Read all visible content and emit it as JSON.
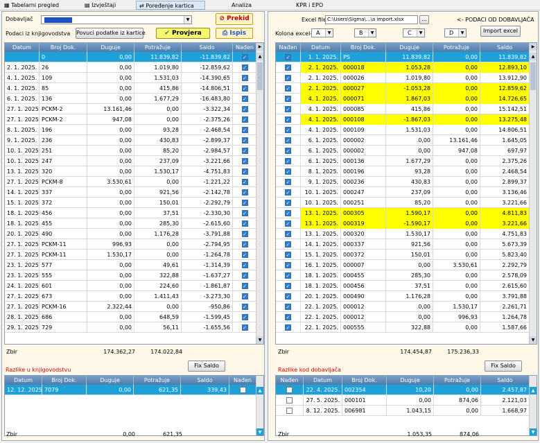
{
  "tabs": [
    {
      "label": "Tabelarni pregled"
    },
    {
      "label": "Izvještaji"
    },
    {
      "label": "Poređenje kartica"
    },
    {
      "label": "Analiza"
    },
    {
      "label": "KPR i EPO"
    }
  ],
  "left": {
    "dobavljac_label": "Dobavljač",
    "prekid": "Prekid",
    "podaci_label": "Podaci iz knjigovodstva",
    "povuci": "Povuci podatke iz kartice",
    "provjera": "Provjera",
    "ispis": "Ispis",
    "headers": [
      "Datum",
      "Broj Dok.",
      "Duguje",
      "Potražuje",
      "Saldo",
      "Nađen"
    ],
    "rows": [
      [
        "",
        "0",
        "0,00",
        "11.839,82",
        "-11.839,82"
      ],
      [
        "2. 1. 2025.",
        "26",
        "0,00",
        "1.019,80",
        "-12.859,62"
      ],
      [
        "4. 1. 2025.",
        "109",
        "0,00",
        "1.531,03",
        "-14.390,65"
      ],
      [
        "4. 1. 2025.",
        "85",
        "0,00",
        "415,86",
        "-14.806,51"
      ],
      [
        "6. 1. 2025.",
        "136",
        "0,00",
        "1.677,29",
        "-16.483,80"
      ],
      [
        "27. 1. 2025.",
        "PCKM-2",
        "13.161,46",
        "0,00",
        "-3.322,34"
      ],
      [
        "27. 1. 2025.",
        "PCKM-2",
        "947,08",
        "0,00",
        "-2.375,26"
      ],
      [
        "8. 1. 2025.",
        "196",
        "0,00",
        "93,28",
        "-2.468,54"
      ],
      [
        "9. 1. 2025.",
        "236",
        "0,00",
        "430,83",
        "-2.899,37"
      ],
      [
        "10. 1. 2025.",
        "251",
        "0,00",
        "85,20",
        "-2.984,57"
      ],
      [
        "10. 1. 2025.",
        "247",
        "0,00",
        "237,09",
        "-3.221,66"
      ],
      [
        "13. 1. 2025.",
        "320",
        "0,00",
        "1.530,17",
        "-4.751,83"
      ],
      [
        "27. 1. 2025.",
        "PCKM-8",
        "3.530,61",
        "0,00",
        "-1.221,22"
      ],
      [
        "14. 1. 2025.",
        "337",
        "0,00",
        "921,56",
        "-2.142,78"
      ],
      [
        "15. 1. 2025.",
        "372",
        "0,00",
        "150,01",
        "-2.292,79"
      ],
      [
        "18. 1. 2025.",
        "456",
        "0,00",
        "37,51",
        "-2.330,30"
      ],
      [
        "18. 1. 2025.",
        "455",
        "0,00",
        "285,30",
        "-2.615,60"
      ],
      [
        "20. 1. 2025.",
        "490",
        "0,00",
        "1.176,28",
        "-3.791,88"
      ],
      [
        "27. 1. 2025.",
        "PCKM-11",
        "996,93",
        "0,00",
        "-2.794,95"
      ],
      [
        "27. 1. 2025.",
        "PCKM-11",
        "1.530,17",
        "0,00",
        "-1.264,78"
      ],
      [
        "23. 1. 2025.",
        "577",
        "0,00",
        "49,61",
        "-1.314,39"
      ],
      [
        "23. 1. 2025.",
        "555",
        "0,00",
        "322,88",
        "-1.637,27"
      ],
      [
        "24. 1. 2025.",
        "601",
        "0,00",
        "224,60",
        "-1.861,87"
      ],
      [
        "27. 1. 2025.",
        "673",
        "0,00",
        "1.411,43",
        "-3.273,30"
      ],
      [
        "27. 1. 2025.",
        "PCKM-16",
        "2.322,44",
        "0,00",
        "-950,86"
      ],
      [
        "28. 1. 2025.",
        "686",
        "0,00",
        "648,59",
        "-1.599,45"
      ],
      [
        "29. 1. 2025.",
        "729",
        "0,00",
        "56,11",
        "-1.655,56"
      ]
    ],
    "zbir": "Zbir",
    "sum_duguje": "174.362,27",
    "sum_potrazuje": "174.022,84",
    "razlike": "Razlike u knjigovodstvu",
    "fix": "Fix Saldo",
    "diff_rows": [
      [
        "12. 12. 2025.",
        "7079",
        "0,00",
        "621,35",
        "339,43"
      ]
    ],
    "diff_zbir_duguje": "0,00",
    "diff_zbir_potrazuje": "621,35"
  },
  "right": {
    "excel_label": "Excel file",
    "excel_path": "C:\\Users\\Sigma\\...\\a import.xlsx",
    "browse": "...",
    "podaci_dob": "<- PODACI OD DOBAVLJAČA",
    "kolona": "Kolona excel-a",
    "cols": [
      "A",
      "B",
      "C",
      "D"
    ],
    "import": "Import excel",
    "headers": [
      "Nađen",
      "Datum",
      "Broj Dok.",
      "Duguje",
      "Potražuje",
      "Saldo"
    ],
    "rows": [
      [
        "1. 1. 2025.",
        "PS",
        "11.839,82",
        "0,00",
        "11.839,82",
        "sel"
      ],
      [
        "2. 1. 2025.",
        "000018",
        "1.053,28",
        "0,00",
        "12.893,10",
        "y"
      ],
      [
        "2. 1. 2025.",
        "000026",
        "1.019,80",
        "0,00",
        "13.912,90",
        ""
      ],
      [
        "2. 1. 2025.",
        "000027",
        "-1.053,28",
        "0,00",
        "12.859,62",
        "y"
      ],
      [
        "4. 1. 2025.",
        "000071",
        "1.867,03",
        "0,00",
        "14.726,65",
        "y"
      ],
      [
        "4. 1. 2025.",
        "000085",
        "415,86",
        "0,00",
        "15.142,51",
        ""
      ],
      [
        "4. 1. 2025.",
        "000108",
        "-1.867,03",
        "0,00",
        "13.275,48",
        "y"
      ],
      [
        "4. 1. 2025.",
        "000109",
        "1.531,03",
        "0,00",
        "14.806,51",
        ""
      ],
      [
        "6. 1. 2025.",
        "000002",
        "0,00",
        "13.161,46",
        "1.645,05",
        ""
      ],
      [
        "6. 1. 2025.",
        "000002",
        "0,00",
        "947,08",
        "697,97",
        ""
      ],
      [
        "6. 1. 2025.",
        "000136",
        "1.677,29",
        "0,00",
        "2.375,26",
        ""
      ],
      [
        "8. 1. 2025.",
        "000196",
        "93,28",
        "0,00",
        "2.468,54",
        ""
      ],
      [
        "9. 1. 2025.",
        "000236",
        "430,83",
        "0,00",
        "2.899,37",
        ""
      ],
      [
        "10. 1. 2025.",
        "000247",
        "237,09",
        "0,00",
        "3.136,46",
        ""
      ],
      [
        "10. 1. 2025.",
        "000251",
        "85,20",
        "0,00",
        "3.221,66",
        ""
      ],
      [
        "13. 1. 2025.",
        "000305",
        "1.590,17",
        "0,00",
        "4.811,83",
        "y"
      ],
      [
        "13. 1. 2025.",
        "000319",
        "-1.590,17",
        "0,00",
        "3.221,66",
        "y"
      ],
      [
        "13. 1. 2025.",
        "000320",
        "1.530,17",
        "0,00",
        "4.751,83",
        ""
      ],
      [
        "14. 1. 2025.",
        "000337",
        "921,56",
        "0,00",
        "5.673,39",
        ""
      ],
      [
        "15. 1. 2025.",
        "000372",
        "150,01",
        "0,00",
        "5.823,40",
        ""
      ],
      [
        "16. 1. 2025.",
        "000007",
        "0,00",
        "3.530,61",
        "2.292,79",
        ""
      ],
      [
        "18. 1. 2025.",
        "000455",
        "285,30",
        "0,00",
        "2.578,09",
        ""
      ],
      [
        "18. 1. 2025.",
        "000456",
        "37,51",
        "0,00",
        "2.615,60",
        ""
      ],
      [
        "20. 1. 2025.",
        "000490",
        "1.176,28",
        "0,00",
        "3.791,88",
        ""
      ],
      [
        "22. 1. 2025.",
        "000012",
        "0,00",
        "1.530,17",
        "2.261,71",
        ""
      ],
      [
        "22. 1. 2025.",
        "000012",
        "0,00",
        "996,93",
        "1.264,78",
        ""
      ],
      [
        "22. 1. 2025.",
        "000555",
        "322,88",
        "0,00",
        "1.587,66",
        ""
      ]
    ],
    "zbir": "Zbir",
    "sum_duguje": "174.454,87",
    "sum_potrazuje": "175.236,33",
    "razlike": "Razlike kod dobavljača",
    "fix": "Fix Saldo",
    "diff_rows": [
      [
        "22. 4. 2025.",
        "002354",
        "10,20",
        "0,00",
        "2.457,87"
      ],
      [
        "27. 5. 2025.",
        "000101",
        "0,00",
        "874,06",
        "2.121,03"
      ],
      [
        "8. 12. 2025.",
        "006981",
        "1.043,15",
        "0,00",
        "1.668,97"
      ]
    ],
    "diff_zbir_duguje": "1.053,35",
    "diff_zbir_potrazuje": "874,06"
  }
}
